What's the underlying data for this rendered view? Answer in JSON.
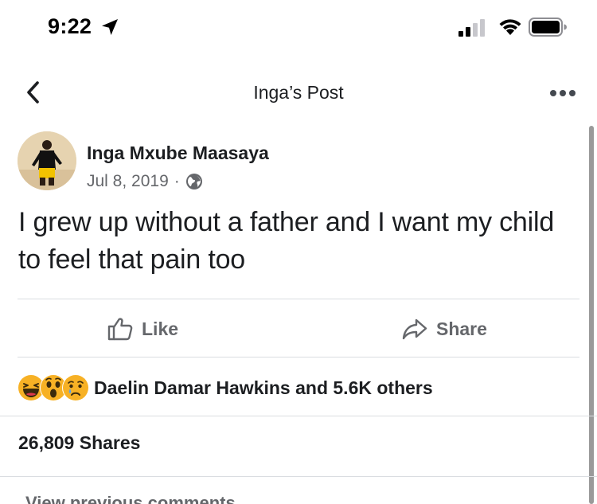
{
  "status_bar": {
    "time": "9:22"
  },
  "nav": {
    "title": "Inga’s Post",
    "back_icon": "chevron-left-icon",
    "more_icon": "more-horizontal-icon"
  },
  "post": {
    "author": "Inga Mxube Maasaya",
    "date": "Jul 8, 2019",
    "separator": "·",
    "privacy_icon": "globe-icon",
    "text": "I grew up without a father and I want my child to feel that pain too"
  },
  "actions": {
    "like_label": "Like",
    "share_label": "Share"
  },
  "reactions": {
    "icons": [
      "haha-icon",
      "wow-icon",
      "sad-icon"
    ],
    "summary": "Daelin Damar Hawkins and 5.6K others"
  },
  "shares": {
    "label": "26,809 Shares"
  },
  "comments": {
    "view_previous": "View previous comments"
  },
  "colors": {
    "text_primary": "#1c1e21",
    "text_secondary": "#65676b",
    "divider": "#dadde1",
    "reaction_yellow": "#f7b125"
  }
}
